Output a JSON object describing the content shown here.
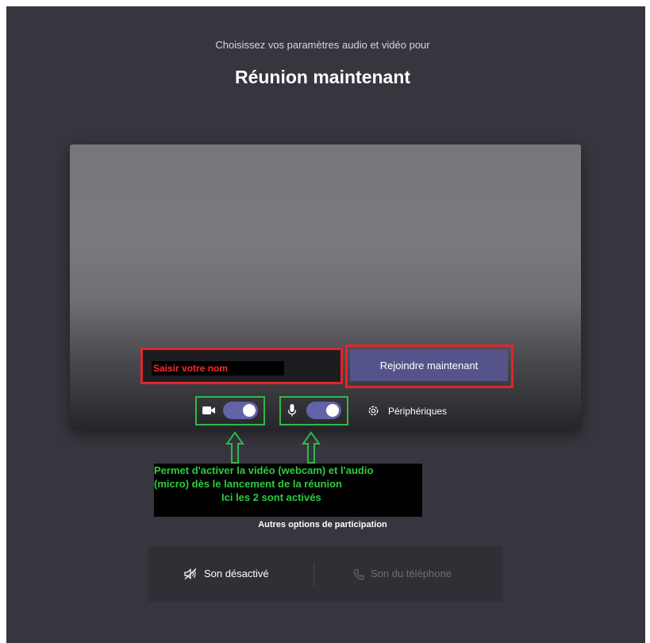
{
  "header": {
    "subtitle": "Choisissez vos paramètres audio et vidéo pour",
    "meeting_title": "Réunion maintenant"
  },
  "join": {
    "name_value": "Saisir votre nom",
    "join_label": "Rejoindre maintenant"
  },
  "controls": {
    "video_toggle_on": true,
    "audio_toggle_on": true,
    "devices_label": "Périphériques"
  },
  "annotation": {
    "lines": [
      "Permet d'activer la vidéo (webcam) et l'audio",
      "(micro) dès le lancement de la réunion",
      "Ici les 2 sont activés"
    ]
  },
  "other_options": {
    "heading": "Autres options de participation",
    "sound_off_label": "Son désactivé",
    "phone_label": "Son du téléphone"
  },
  "colors": {
    "background": "#37363e",
    "accent": "#6264a7",
    "join_button": "#55548a",
    "highlight_red": "#e0252c",
    "highlight_green": "#2fb84a"
  },
  "icons": {
    "video": "video-camera-icon",
    "mic": "microphone-icon",
    "devices": "gear-icon",
    "sound_off": "speaker-muted-icon",
    "phone": "phone-icon",
    "arrow": "up-arrow-icon"
  }
}
